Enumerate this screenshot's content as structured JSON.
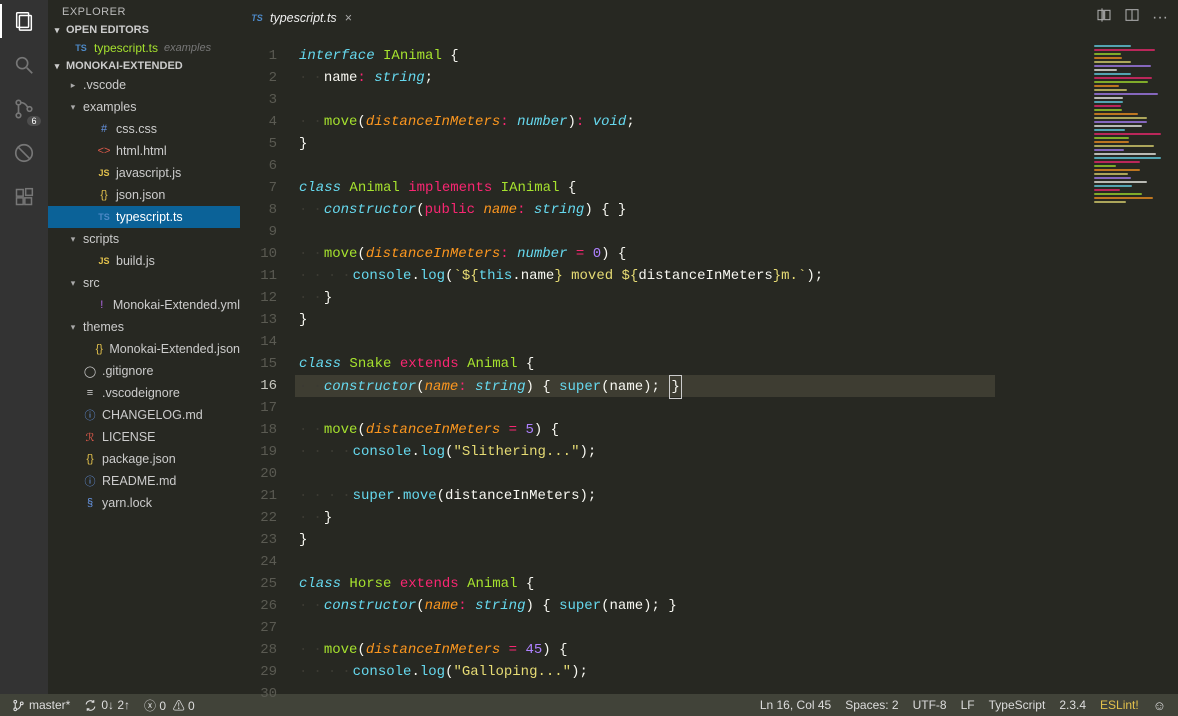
{
  "sidebar": {
    "title": "EXPLORER",
    "badge": "6",
    "openEditors": {
      "header": "OPEN EDITORS",
      "items": [
        {
          "icon": "ts",
          "name": "typescript.ts",
          "path": "examples"
        }
      ]
    },
    "project": {
      "header": "MONOKAI-EXTENDED",
      "tree": [
        {
          "d": 1,
          "t": "folder",
          "open": false,
          "label": ".vscode"
        },
        {
          "d": 1,
          "t": "folder",
          "open": true,
          "label": "examples"
        },
        {
          "d": 2,
          "t": "file",
          "icon": "hash",
          "label": "css.css"
        },
        {
          "d": 2,
          "t": "file",
          "icon": "tag",
          "label": "html.html"
        },
        {
          "d": 2,
          "t": "file",
          "icon": "js",
          "label": "javascript.js"
        },
        {
          "d": 2,
          "t": "file",
          "icon": "json",
          "label": "json.json"
        },
        {
          "d": 2,
          "t": "file",
          "icon": "ts",
          "label": "typescript.ts",
          "sel": true
        },
        {
          "d": 1,
          "t": "folder",
          "open": true,
          "label": "scripts"
        },
        {
          "d": 2,
          "t": "file",
          "icon": "js",
          "label": "build.js"
        },
        {
          "d": 1,
          "t": "folder",
          "open": true,
          "label": "src"
        },
        {
          "d": 2,
          "t": "file",
          "icon": "excl",
          "label": "Monokai-Extended.yml"
        },
        {
          "d": 1,
          "t": "folder",
          "open": true,
          "label": "themes"
        },
        {
          "d": 2,
          "t": "file",
          "icon": "json",
          "label": "Monokai-Extended.json"
        },
        {
          "d": 1,
          "t": "file",
          "icon": "git",
          "label": ".gitignore"
        },
        {
          "d": 1,
          "t": "file",
          "icon": "lines",
          "label": ".vscodeignore"
        },
        {
          "d": 1,
          "t": "file",
          "icon": "info",
          "label": "CHANGELOG.md"
        },
        {
          "d": 1,
          "t": "file",
          "icon": "red",
          "label": "LICENSE"
        },
        {
          "d": 1,
          "t": "file",
          "icon": "json",
          "label": "package.json"
        },
        {
          "d": 1,
          "t": "file",
          "icon": "info",
          "label": "README.md"
        },
        {
          "d": 1,
          "t": "file",
          "icon": "yarn",
          "label": "yarn.lock"
        }
      ]
    }
  },
  "tab": {
    "icon": "ts",
    "name": "typescript.ts"
  },
  "currentLine": 16,
  "code": [
    [
      [
        "k",
        "interface"
      ],
      [
        "p",
        " "
      ],
      [
        "cls",
        "IAnimal"
      ],
      [
        "p",
        " {"
      ]
    ],
    [
      [
        "ws",
        "··"
      ],
      [
        "id",
        "name"
      ],
      [
        "r",
        ":"
      ],
      [
        "p",
        " "
      ],
      [
        "ty",
        "string"
      ],
      [
        "p",
        ";"
      ]
    ],
    [],
    [
      [
        "ws",
        "··"
      ],
      [
        "fn",
        "move"
      ],
      [
        "p",
        "("
      ],
      [
        "var",
        "distanceInMeters"
      ],
      [
        "r",
        ":"
      ],
      [
        "p",
        " "
      ],
      [
        "ty",
        "number"
      ],
      [
        "p",
        ")"
      ],
      [
        "r",
        ":"
      ],
      [
        "p",
        " "
      ],
      [
        "ty",
        "void"
      ],
      [
        "p",
        ";"
      ]
    ],
    [
      [
        "p",
        "}"
      ]
    ],
    [],
    [
      [
        "k",
        "class"
      ],
      [
        "p",
        " "
      ],
      [
        "cls",
        "Animal"
      ],
      [
        "p",
        " "
      ],
      [
        "r",
        "implements"
      ],
      [
        "p",
        " "
      ],
      [
        "cls",
        "IAnimal"
      ],
      [
        "p",
        " {"
      ]
    ],
    [
      [
        "ws",
        "··"
      ],
      [
        "k",
        "constructor"
      ],
      [
        "p",
        "("
      ],
      [
        "r",
        "public"
      ],
      [
        "p",
        " "
      ],
      [
        "var",
        "name"
      ],
      [
        "r",
        ":"
      ],
      [
        "p",
        " "
      ],
      [
        "ty",
        "string"
      ],
      [
        "p",
        ") { }"
      ]
    ],
    [],
    [
      [
        "ws",
        "··"
      ],
      [
        "fn",
        "move"
      ],
      [
        "p",
        "("
      ],
      [
        "var",
        "distanceInMeters"
      ],
      [
        "r",
        ":"
      ],
      [
        "p",
        " "
      ],
      [
        "ty",
        "number"
      ],
      [
        "p",
        " "
      ],
      [
        "r",
        "="
      ],
      [
        "p",
        " "
      ],
      [
        "num",
        "0"
      ],
      [
        "p",
        ") {"
      ]
    ],
    [
      [
        "ws",
        "····"
      ],
      [
        "kn",
        "console"
      ],
      [
        "p",
        "."
      ],
      [
        "fncall",
        "log"
      ],
      [
        "p",
        "("
      ],
      [
        "str",
        "`${"
      ],
      [
        "kn",
        "this"
      ],
      [
        "p",
        "."
      ],
      [
        "id",
        "name"
      ],
      [
        "str",
        "} moved ${"
      ],
      [
        "id",
        "distanceInMeters"
      ],
      [
        "str",
        "}m.`"
      ],
      [
        "p",
        ");"
      ]
    ],
    [
      [
        "ws",
        "··"
      ],
      [
        "p",
        "}"
      ]
    ],
    [
      [
        "p",
        "}"
      ]
    ],
    [],
    [
      [
        "k",
        "class"
      ],
      [
        "p",
        " "
      ],
      [
        "cls",
        "Snake"
      ],
      [
        "p",
        " "
      ],
      [
        "r",
        "extends"
      ],
      [
        "p",
        " "
      ],
      [
        "cls",
        "Animal"
      ],
      [
        "p",
        " {"
      ]
    ],
    [
      [
        "ws",
        "··"
      ],
      [
        "k",
        "constructor"
      ],
      [
        "p",
        "("
      ],
      [
        "var",
        "name"
      ],
      [
        "r",
        ":"
      ],
      [
        "p",
        " "
      ],
      [
        "ty",
        "string"
      ],
      [
        "p",
        ") "
      ],
      [
        "p",
        "{"
      ],
      [
        "p",
        " "
      ],
      [
        "kn",
        "super"
      ],
      [
        "p",
        "(name); "
      ],
      [
        "cursor",
        "}"
      ]
    ],
    [],
    [
      [
        "ws",
        "··"
      ],
      [
        "fn",
        "move"
      ],
      [
        "p",
        "("
      ],
      [
        "var",
        "distanceInMeters"
      ],
      [
        "p",
        " "
      ],
      [
        "r",
        "="
      ],
      [
        "p",
        " "
      ],
      [
        "num",
        "5"
      ],
      [
        "p",
        ") {"
      ]
    ],
    [
      [
        "ws",
        "····"
      ],
      [
        "kn",
        "console"
      ],
      [
        "p",
        "."
      ],
      [
        "fncall",
        "log"
      ],
      [
        "p",
        "("
      ],
      [
        "str",
        "\"Slithering...\""
      ],
      [
        "p",
        ");"
      ]
    ],
    [],
    [
      [
        "ws",
        "····"
      ],
      [
        "kn",
        "super"
      ],
      [
        "p",
        "."
      ],
      [
        "fncall",
        "move"
      ],
      [
        "p",
        "(distanceInMeters);"
      ]
    ],
    [
      [
        "ws",
        "··"
      ],
      [
        "p",
        "}"
      ]
    ],
    [
      [
        "p",
        "}"
      ]
    ],
    [],
    [
      [
        "k",
        "class"
      ],
      [
        "p",
        " "
      ],
      [
        "cls",
        "Horse"
      ],
      [
        "p",
        " "
      ],
      [
        "r",
        "extends"
      ],
      [
        "p",
        " "
      ],
      [
        "cls",
        "Animal"
      ],
      [
        "p",
        " {"
      ]
    ],
    [
      [
        "ws",
        "··"
      ],
      [
        "k",
        "constructor"
      ],
      [
        "p",
        "("
      ],
      [
        "var",
        "name"
      ],
      [
        "r",
        ":"
      ],
      [
        "p",
        " "
      ],
      [
        "ty",
        "string"
      ],
      [
        "p",
        ") { "
      ],
      [
        "kn",
        "super"
      ],
      [
        "p",
        "(name); }"
      ]
    ],
    [],
    [
      [
        "ws",
        "··"
      ],
      [
        "fn",
        "move"
      ],
      [
        "p",
        "("
      ],
      [
        "var",
        "distanceInMeters"
      ],
      [
        "p",
        " "
      ],
      [
        "r",
        "="
      ],
      [
        "p",
        " "
      ],
      [
        "num",
        "45"
      ],
      [
        "p",
        ") {"
      ]
    ],
    [
      [
        "ws",
        "····"
      ],
      [
        "kn",
        "console"
      ],
      [
        "p",
        "."
      ],
      [
        "fncall",
        "log"
      ],
      [
        "p",
        "("
      ],
      [
        "str",
        "\"Galloping...\""
      ],
      [
        "p",
        ");"
      ]
    ],
    []
  ],
  "status": {
    "branch": "master*",
    "sync": "0↓ 2↑",
    "problems": "0  0",
    "pos": "Ln 16, Col 45",
    "spaces": "Spaces: 2",
    "enc": "UTF-8",
    "eol": "LF",
    "lang": "TypeScript",
    "ver": "2.3.4",
    "eslint": "ESLint!"
  },
  "iconGlyph": {
    "hash": "#",
    "tag": "<>",
    "js": "JS",
    "json": "{}",
    "ts": "TS",
    "excl": "!",
    "git": "◯",
    "lines": "≡",
    "info": "ⓘ",
    "red": "ℛ",
    "yarn": "§"
  }
}
